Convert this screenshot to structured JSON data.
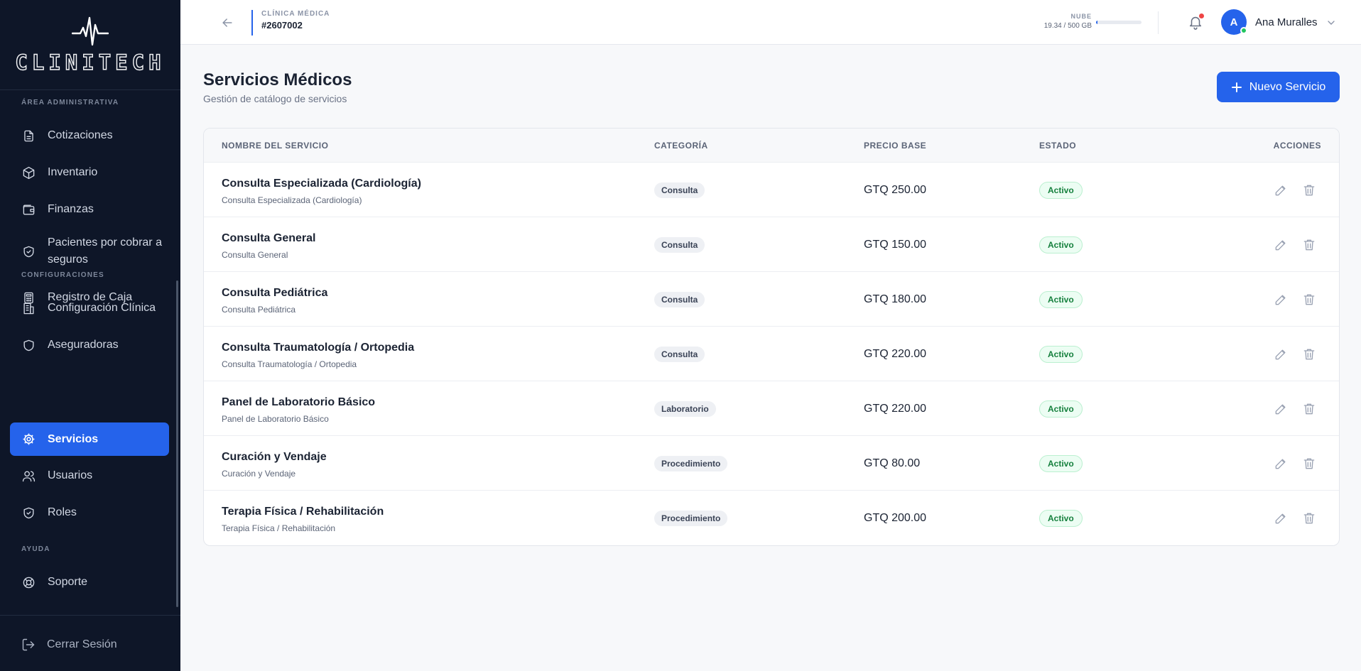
{
  "brand": {
    "name": "CLINITECH",
    "logo_icon": "heartbeat-icon"
  },
  "sidebar": {
    "sections": [
      {
        "label": "ÁREA ADMINISTRATIVA"
      },
      {
        "label": "CONFIGURACIONES"
      },
      {
        "label": "AYUDA"
      }
    ],
    "items": [
      {
        "label": "Cotizaciones",
        "icon": "document-icon"
      },
      {
        "label": "Inventario",
        "icon": "box-icon"
      },
      {
        "label": "Finanzas",
        "icon": "wallet-icon"
      },
      {
        "label": "Pacientes por cobrar a",
        "label2": "seguros",
        "icon": "shield-check-icon"
      },
      {
        "label": "Registro de Caja",
        "icon": "calculator-icon"
      },
      {
        "label": "Configuración Clínica",
        "icon": "building-icon"
      },
      {
        "label": "Aseguradoras",
        "icon": "shield-icon"
      },
      {
        "label": "Servicios",
        "icon": "gear-icon",
        "active": true
      },
      {
        "label": "Usuarios",
        "icon": "users-icon"
      },
      {
        "label": "Roles",
        "icon": "shield-check-icon"
      },
      {
        "label": "Soporte",
        "icon": "lifebuoy-icon"
      }
    ],
    "logout_label": "Cerrar Sesión"
  },
  "header": {
    "clinic_label": "CLÍNICA MÉDICA",
    "clinic_id": "#2607002",
    "cloud_label": "NUBE",
    "cloud_usage": "19.34 / 500 GB",
    "cloud_fraction": 0.0387,
    "user_initial": "A",
    "user_name": "Ana Muralles"
  },
  "page": {
    "title": "Servicios Médicos",
    "subtitle": "Gestión de catálogo de servicios",
    "new_button": "Nuevo Servicio"
  },
  "table": {
    "columns": {
      "name": "NOMBRE DEL SERVICIO",
      "category": "CATEGORÍA",
      "price": "PRECIO BASE",
      "status": "ESTADO",
      "actions": "ACCIONES"
    },
    "rows": [
      {
        "name": "Consulta Especializada (Cardiología)",
        "desc": "Consulta Especializada (Cardiología)",
        "category": "Consulta",
        "price": "GTQ 250.00",
        "status": "Activo"
      },
      {
        "name": "Consulta General",
        "desc": "Consulta General",
        "category": "Consulta",
        "price": "GTQ 150.00",
        "status": "Activo"
      },
      {
        "name": "Consulta Pediátrica",
        "desc": "Consulta Pediátrica",
        "category": "Consulta",
        "price": "GTQ 180.00",
        "status": "Activo"
      },
      {
        "name": "Consulta Traumatología / Ortopedia",
        "desc": "Consulta Traumatología / Ortopedia",
        "category": "Consulta",
        "price": "GTQ 220.00",
        "status": "Activo"
      },
      {
        "name": "Panel de Laboratorio Básico",
        "desc": "Panel de Laboratorio Básico",
        "category": "Laboratorio",
        "price": "GTQ 220.00",
        "status": "Activo"
      },
      {
        "name": "Curación y Vendaje",
        "desc": "Curación y Vendaje",
        "category": "Procedimiento",
        "price": "GTQ 80.00",
        "status": "Activo"
      },
      {
        "name": "Terapia Física / Rehabilitación",
        "desc": "Terapia Física / Rehabilitación",
        "category": "Procedimiento",
        "price": "GTQ 200.00",
        "status": "Activo"
      }
    ]
  },
  "colors": {
    "sidebar_bg": "#0e1628",
    "accent": "#2563eb",
    "status_active": "#15803d",
    "notification_dot": "#ef4444",
    "online_dot": "#22c55e"
  }
}
